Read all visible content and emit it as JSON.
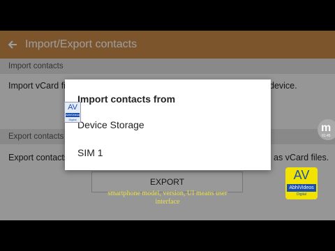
{
  "appbar": {
    "title": "Import/Export contacts"
  },
  "sections": {
    "import_header": "Import contacts",
    "import_body_left": "Import vCard fi",
    "import_body_right": "device.",
    "export_header": "Export contacts",
    "export_body_left": "Export contacts",
    "export_body_right": "as vCard files.",
    "export_button": "EXPORT"
  },
  "dialog": {
    "title": "Import contacts from",
    "options": [
      "Device Storage",
      "SIM 1"
    ]
  },
  "overlay": {
    "caption": "smartphone model, version, UI means user interface",
    "logo_big": "AV",
    "logo_name": "AbhiVideos",
    "logo_sub": "Digital",
    "badge_letter": "m",
    "badge_time": "01:45"
  },
  "colors": {
    "appbar": "#c8894a",
    "caption": "#e8e04a",
    "logo_bg": "#f2e200"
  }
}
